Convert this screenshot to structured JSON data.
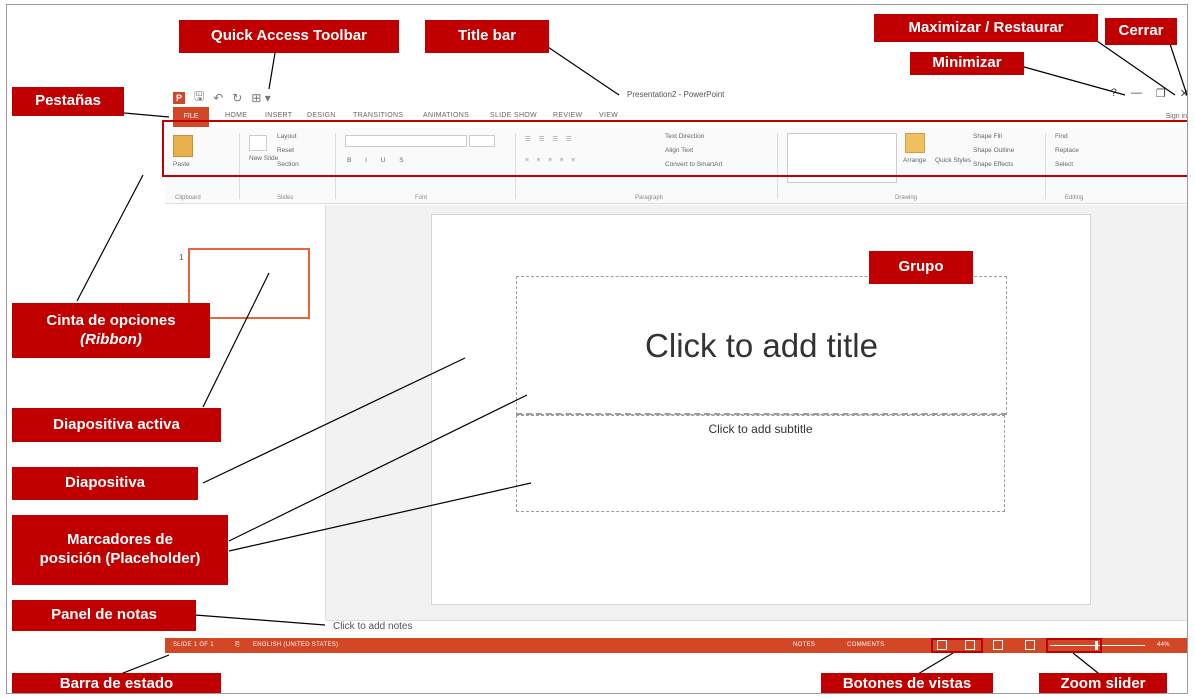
{
  "window": {
    "title": "Presentation2 - PowerPoint",
    "sign_in": "Sign in",
    "min": "—",
    "max": "❐",
    "close": "✕",
    "help": "?"
  },
  "qat": {
    "save": "🖫",
    "undo": "↶",
    "redo": "↻",
    "custom": "⊞ ▾"
  },
  "tabs": [
    "FILE",
    "HOME",
    "INSERT",
    "DESIGN",
    "TRANSITIONS",
    "ANIMATIONS",
    "SLIDE SHOW",
    "REVIEW",
    "VIEW"
  ],
  "ribbon": {
    "clipboard": {
      "paste": "Paste",
      "label": "Clipboard"
    },
    "slides": {
      "new_slide": "New Slide",
      "layout": "Layout",
      "reset": "Reset",
      "section": "Section",
      "label": "Slides"
    },
    "font": {
      "label": "Font"
    },
    "paragraph": {
      "text_direction": "Text Direction",
      "align_text": "Align Text",
      "convert": "Convert to SmartArt",
      "label": "Paragraph"
    },
    "drawing": {
      "arrange": "Arrange",
      "quick_styles": "Quick Styles",
      "shape_fill": "Shape Fill",
      "shape_outline": "Shape Outline",
      "shape_effects": "Shape Effects",
      "label": "Drawing"
    },
    "editing": {
      "find": "Find",
      "replace": "Replace",
      "select": "Select",
      "label": "Editing"
    }
  },
  "thumbnail": {
    "number": "1"
  },
  "slide": {
    "title_placeholder": "Click to add title",
    "subtitle_placeholder": "Click to add subtitle"
  },
  "notes": {
    "placeholder": "Click to add notes"
  },
  "statusbar": {
    "slide_count": "SLIDE 1 OF 1",
    "language": "ENGLISH (UNITED STATES)",
    "notes": "NOTES",
    "comments": "COMMENTS",
    "zoom": "44%"
  },
  "labels": {
    "qat": "Quick Access Toolbar",
    "title_bar": "Title bar",
    "maximize": "Maximizar / Restaurar",
    "close": "Cerrar",
    "minimize": "Minimizar",
    "tabs": "Pestañas",
    "group": "Grupo",
    "ribbon_line1": "Cinta de opciones",
    "ribbon_line2": "(Ribbon)",
    "active_slide": "Diapositiva activa",
    "slide": "Diapositiva",
    "placeholder_line1": "Marcadores de",
    "placeholder_line2": "posición (Placeholder)",
    "notes_panel": "Panel de notas",
    "status_bar": "Barra de estado",
    "view_buttons": "Botones de vistas",
    "zoom_slider": "Zoom slider"
  },
  "colors": {
    "accent": "#d24726",
    "label": "#c00000"
  }
}
